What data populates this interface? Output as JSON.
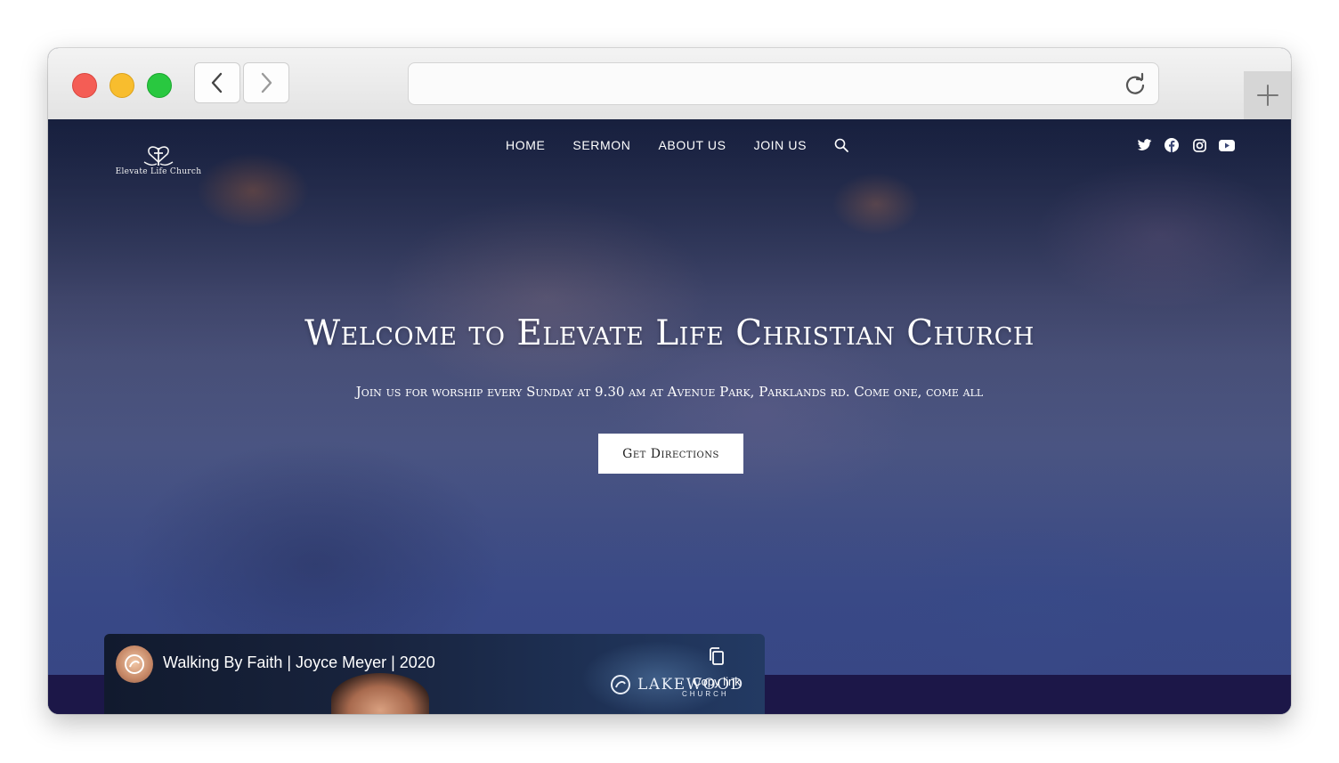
{
  "browser": {
    "back_icon": "chevron-left-icon",
    "forward_icon": "chevron-right-icon",
    "url_value": "",
    "reload_icon": "reload-icon",
    "new_tab_icon": "plus-icon"
  },
  "site": {
    "logo_text": "Elevate Life Church",
    "nav": [
      {
        "label": "HOME"
      },
      {
        "label": "SERMON"
      },
      {
        "label": "ABOUT US"
      },
      {
        "label": "JOIN US"
      }
    ],
    "search_icon": "search-icon",
    "social": [
      "twitter-icon",
      "facebook-icon",
      "instagram-icon",
      "youtube-icon"
    ]
  },
  "hero": {
    "title": "Welcome to Elevate Life Christian Church",
    "subtitle": "Join us for worship every Sunday at 9.30 am at Avenue Park, Parklands rd. Come one, come all",
    "cta_label": "Get Directions"
  },
  "video": {
    "title": "Walking By Faith | Joyce Meyer | 2020",
    "brand": "LAKEWOOD",
    "brand_sub": "CHURCH",
    "copy_label": "Copy link"
  },
  "colors": {
    "hero_tint": "#3c4b86",
    "strip": "#1c1748",
    "traffic_red": "#f45d55",
    "traffic_yellow": "#f8bd2e",
    "traffic_green": "#29c840"
  }
}
